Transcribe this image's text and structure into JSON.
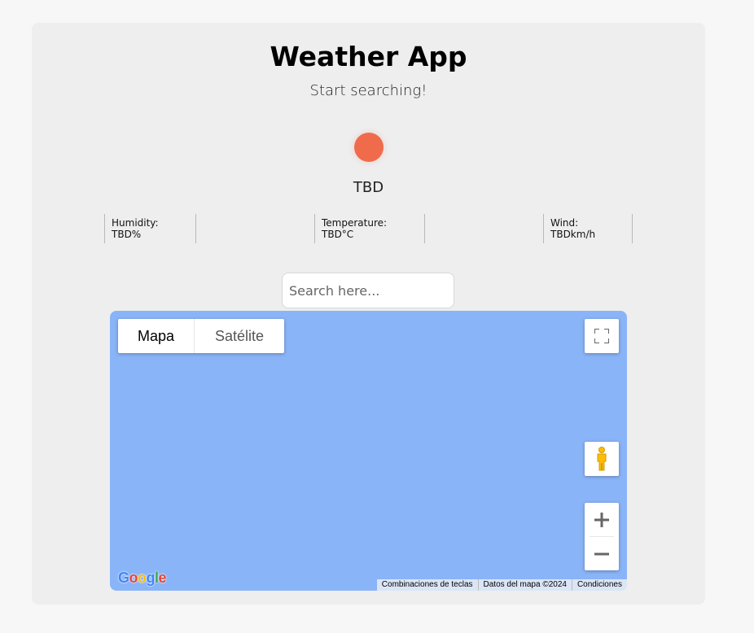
{
  "app": {
    "title": "Weather App",
    "subtitle": "Start searching!",
    "condition": "TBD",
    "accent_color": "#ef6b4b"
  },
  "stats": {
    "humidity": "Humidity: TBD%",
    "temperature": "Temperature: TBD°C",
    "wind": "Wind: TBDkm/h"
  },
  "search": {
    "placeholder": "Search here...",
    "value": ""
  },
  "map": {
    "background_color": "#8ab4f8",
    "map_type_options": [
      "Mapa",
      "Satélite"
    ],
    "selected_map_type": "Mapa",
    "logo_text": [
      "G",
      "o",
      "o",
      "g",
      "l",
      "e"
    ],
    "attribution": {
      "shortcuts": "Combinaciones de teclas",
      "map_data": "Datos del mapa ©2024",
      "terms": "Condiciones"
    },
    "icons": {
      "fullscreen": "fullscreen-icon",
      "pegman": "pegman-icon",
      "zoom_in": "plus-icon",
      "zoom_out": "minus-icon"
    }
  }
}
